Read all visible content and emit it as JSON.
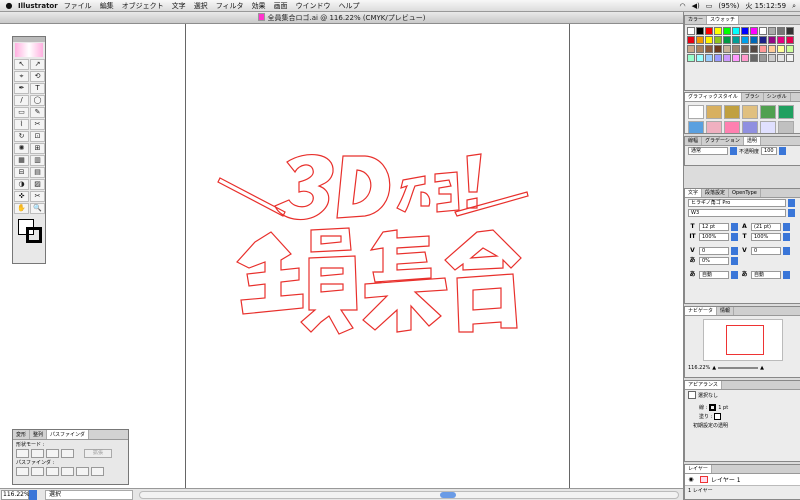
{
  "menubar": {
    "app_name": "Illustrator",
    "items": [
      "ファイル",
      "編集",
      "オブジェクト",
      "文字",
      "選択",
      "フィルタ",
      "効果",
      "画面",
      "ウインドウ",
      "ヘルプ"
    ],
    "battery": "(95%)",
    "clock": "火 15:12:59"
  },
  "document": {
    "title": "全員集合ロゴ.ai @ 116.22% (CMYK/プレビュー)",
    "artwork_color": "#e8302c"
  },
  "statusbar": {
    "zoom": "116.22%",
    "status": "選択"
  },
  "tools": {
    "items": [
      "↖",
      "↗",
      "⌖",
      "⟲",
      "✒",
      "T",
      "/",
      "◯",
      "▭",
      "✎",
      "⌇",
      "✂",
      "↻",
      "⊡",
      "✺",
      "⊞",
      "▦",
      "▥",
      "⊟",
      "▤",
      "◑",
      "▨",
      "✜",
      "✂",
      "✋",
      "🔍"
    ]
  },
  "pathfinder": {
    "tabs": [
      "変形",
      "整列",
      "パスファインダ"
    ],
    "shape_mode_label": "形状モード :",
    "expand_label": "拡張",
    "pathfinder_label": "パスファインダ :"
  },
  "panels": {
    "color_tabs": [
      "カラー",
      "スウォッチ"
    ],
    "graphic_tabs": [
      "グラフィックスタイル",
      "ブラシ",
      "シンボル"
    ],
    "stroke_tabs": [
      "線幅",
      "グラデーション",
      "透明"
    ],
    "blend_mode": "通常",
    "opacity_label": "不透明度",
    "opacity_value": "100",
    "char_tabs": [
      "文字",
      "段落設定",
      "OpenType"
    ],
    "font_family": "ヒラギノ角ゴ Pro",
    "font_weight": "W3",
    "font_size": "12 pt",
    "leading": "(21 pt)",
    "vert_scale": "100%",
    "horiz_scale": "100%",
    "kerning": "0",
    "tracking": "0",
    "tsume": "0%",
    "auto1": "自動",
    "auto2": "自動",
    "nav_tabs": [
      "ナビゲータ",
      "情報"
    ],
    "nav_zoom": "116.22%",
    "appearance_tab": "アピアランス",
    "appearance_none": "選択なし",
    "stroke_label": "線 :",
    "stroke_value": "1 pt",
    "fill_label": "塗り :",
    "default_transparency": "初期設定の透明",
    "layers_tab": "レイヤー",
    "layer_name": "レイヤー 1",
    "layer_count": "1 レイヤー"
  }
}
